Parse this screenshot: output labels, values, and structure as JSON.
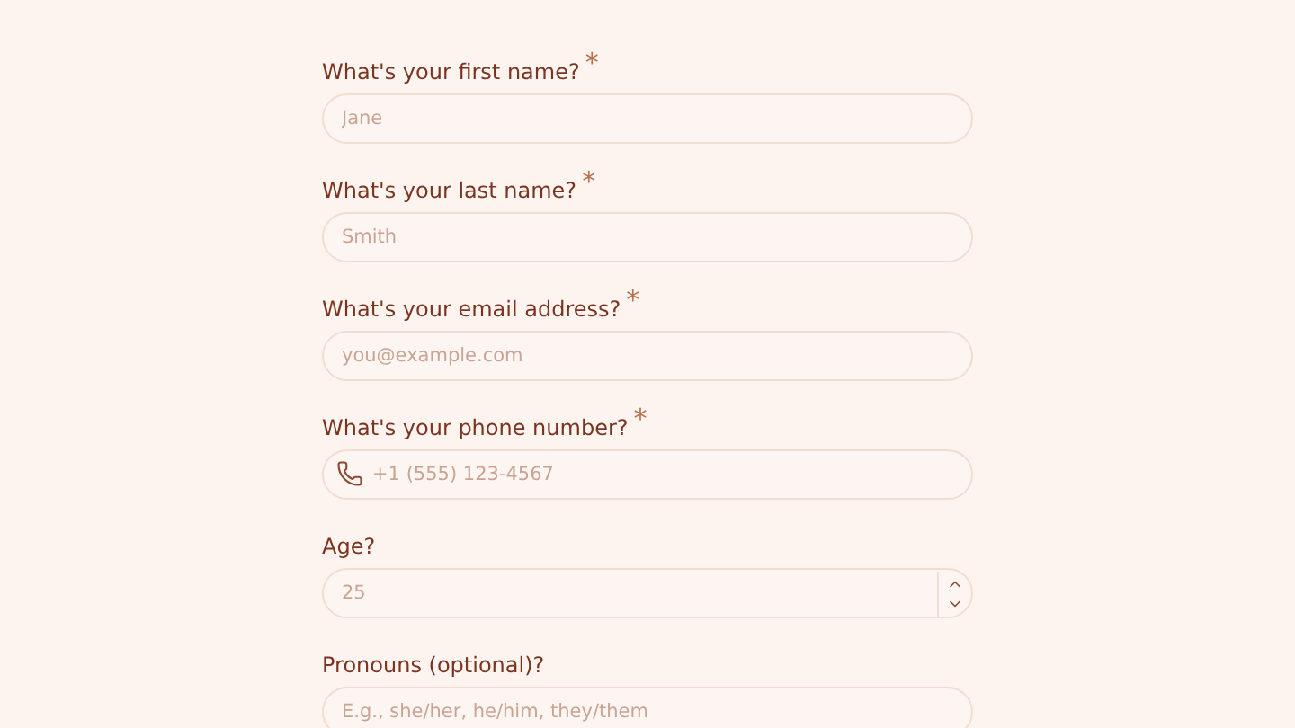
{
  "form": {
    "fields": [
      {
        "kind": "text",
        "label": "What's your first name?",
        "required_mark": "*",
        "placeholder": "Jane"
      },
      {
        "kind": "text",
        "label": "What's your last name?",
        "required_mark": "*",
        "placeholder": "Smith"
      },
      {
        "kind": "text",
        "label": "What's your email address?",
        "required_mark": "*",
        "placeholder": "you@example.com"
      },
      {
        "kind": "phone",
        "label": "What's your phone number?",
        "required_mark": "*",
        "placeholder": "+1 (555) 123-4567"
      },
      {
        "kind": "number",
        "label": "Age?",
        "placeholder": "25"
      },
      {
        "kind": "text",
        "label": "Pronouns (optional)?",
        "placeholder": "E.g., she/her, he/him, they/them"
      }
    ]
  }
}
